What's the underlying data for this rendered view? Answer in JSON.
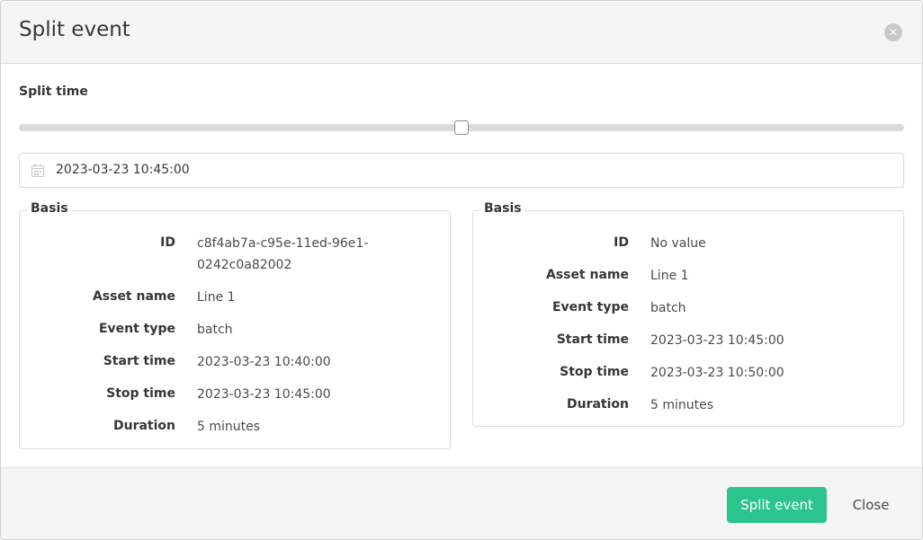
{
  "modal": {
    "title": "Split event",
    "close_icon": "close-icon"
  },
  "split_time": {
    "label": "Split time",
    "slider_position": 0.5,
    "value": "2023-03-23 10:45:00",
    "icon": "calendar-icon"
  },
  "left_panel": {
    "legend": "Basis",
    "rows": [
      {
        "label": "ID",
        "value": "c8f4ab7a-c95e-11ed-96e1-0242c0a82002"
      },
      {
        "label": "Asset name",
        "value": "Line 1"
      },
      {
        "label": "Event type",
        "value": "batch"
      },
      {
        "label": "Start time",
        "value": "2023-03-23 10:40:00"
      },
      {
        "label": "Stop time",
        "value": "2023-03-23 10:45:00"
      },
      {
        "label": "Duration",
        "value": "5 minutes"
      }
    ]
  },
  "right_panel": {
    "legend": "Basis",
    "rows": [
      {
        "label": "ID",
        "value": "No value"
      },
      {
        "label": "Asset name",
        "value": "Line 1"
      },
      {
        "label": "Event type",
        "value": "batch"
      },
      {
        "label": "Start time",
        "value": "2023-03-23 10:45:00"
      },
      {
        "label": "Stop time",
        "value": "2023-03-23 10:50:00"
      },
      {
        "label": "Duration",
        "value": "5 minutes"
      }
    ]
  },
  "footer": {
    "split_label": "Split event",
    "close_label": "Close"
  },
  "colors": {
    "primary": "#2bc48c",
    "header_bg": "#f5f5f5",
    "border": "#dbdbdb"
  }
}
